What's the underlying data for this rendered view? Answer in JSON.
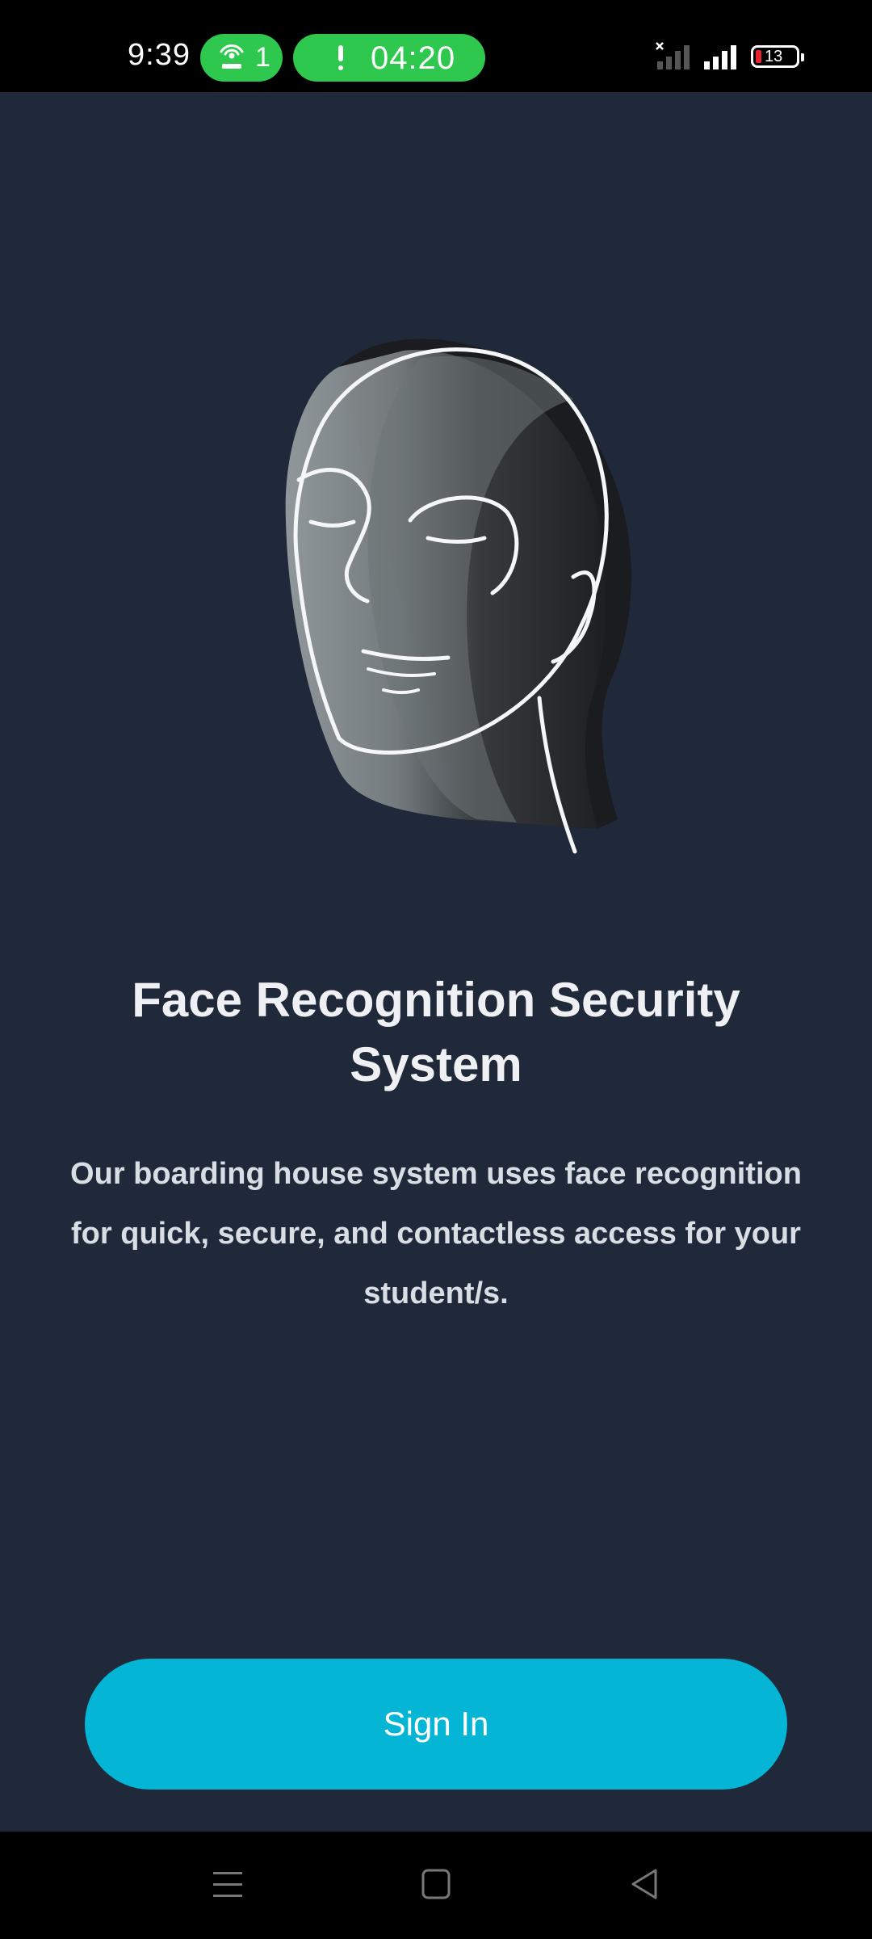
{
  "status_bar": {
    "time": "9:39",
    "hotspot_count": "1",
    "call_timer": "04:20",
    "battery_level": "13",
    "hotspot_icon": "hotspot-icon",
    "alert_icon": "alert-icon",
    "signal_icon_1": "signal-no-service-icon",
    "signal_icon_2": "signal-full-icon",
    "battery_icon": "battery-low-icon",
    "accent_color": "#2dc84d"
  },
  "hero": {
    "icon": "face-scan-illustration"
  },
  "main": {
    "title": "Face Recognition Security System",
    "description": "Our boarding house system uses face recognition for quick, secure, and contactless access for your student/s.",
    "sign_in_label": "Sign In",
    "background_color": "#1f293a",
    "button_color": "#05b5d5"
  },
  "nav_bar": {
    "menu_icon": "menu-icon",
    "home_icon": "home-icon",
    "back_icon": "back-icon"
  }
}
